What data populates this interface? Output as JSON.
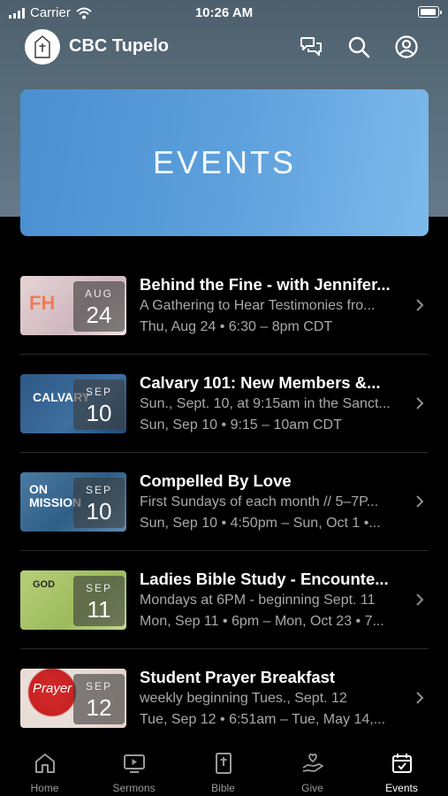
{
  "status_bar": {
    "carrier": "Carrier",
    "time": "10:26 AM"
  },
  "header": {
    "title": "CBC Tupelo",
    "icons": [
      "chat-icon",
      "search-icon",
      "profile-icon"
    ]
  },
  "banner": {
    "title": "EVENTS"
  },
  "events": [
    {
      "title": "Behind the Fine - with Jennifer...",
      "subtitle": "A Gathering to Hear Testimonies fro...",
      "when": "Thu, Aug 24 • 6:30 – 8pm CDT",
      "month": "AUG",
      "day": "24",
      "thumb_text": "FH",
      "thumb_color": "#d9c6c6"
    },
    {
      "title": "Calvary 101: New Members &...",
      "subtitle": "Sun., Sept. 10, at 9:15am in the Sanct...",
      "when": "Sun, Sep 10 • 9:15 – 10am CDT",
      "month": "SEP",
      "day": "10",
      "thumb_text": "CALVARY",
      "thumb_color": "#2f5a86"
    },
    {
      "title": "Compelled By Love",
      "subtitle": "First Sundays of each month // 5–7P...",
      "when": "Sun, Sep 10 • 4:50pm – Sun, Oct 1 •...",
      "month": "SEP",
      "day": "10",
      "thumb_text": "ON MISSION",
      "thumb_color": "#3e6a8e"
    },
    {
      "title": "Ladies Bible Study - Encounte...",
      "subtitle": "Mondays at 6PM - beginning Sept. 11",
      "when": "Mon, Sep 11 • 6pm – Mon, Oct 23 • 7...",
      "month": "SEP",
      "day": "11",
      "thumb_text": "GOD",
      "thumb_color": "#a7c26a"
    },
    {
      "title": "Student Prayer Breakfast",
      "subtitle": "weekly beginning Tues., Sept. 12",
      "when": "Tue, Sep 12 • 6:51am – Tue, May 14,...",
      "month": "SEP",
      "day": "12",
      "thumb_text": "Prayer",
      "thumb_color": "#e8dcd6"
    }
  ],
  "tabs": [
    {
      "label": "Home",
      "icon": "home-icon",
      "active": false
    },
    {
      "label": "Sermons",
      "icon": "tv-icon",
      "active": false
    },
    {
      "label": "Bible",
      "icon": "bible-icon",
      "active": false
    },
    {
      "label": "Give",
      "icon": "give-icon",
      "active": false
    },
    {
      "label": "Events",
      "icon": "calendar-icon",
      "active": true
    }
  ]
}
